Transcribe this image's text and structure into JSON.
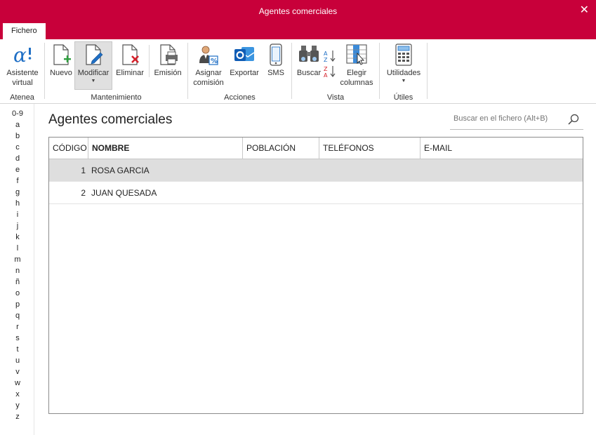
{
  "window": {
    "title": "Agentes comerciales",
    "close_glyph": "✕"
  },
  "tabs": [
    {
      "label": "Fichero",
      "active": true
    }
  ],
  "ribbon": {
    "groups": [
      {
        "label": "Atenea",
        "buttons": [
          {
            "label1": "Asistente",
            "label2": "virtual",
            "icon": "alpha-icon"
          }
        ]
      },
      {
        "label": "Mantenimiento",
        "buttons": [
          {
            "label1": "Nuevo",
            "icon": "new-document-icon"
          },
          {
            "label1": "Modificar",
            "icon": "edit-document-icon",
            "selected": true,
            "has_dropdown": true
          },
          {
            "label1": "Eliminar",
            "icon": "delete-document-icon"
          },
          {
            "label1": "Emisión",
            "icon": "print-document-icon"
          }
        ]
      },
      {
        "label": "Acciones",
        "buttons": [
          {
            "label1": "Asignar",
            "label2": "comisión",
            "icon": "assign-commission-icon"
          },
          {
            "label1": "Exportar",
            "icon": "outlook-icon"
          },
          {
            "label1": "SMS",
            "icon": "phone-icon"
          }
        ]
      },
      {
        "label": "Vista",
        "buttons": [
          {
            "label1": "Buscar",
            "icon": "binoculars-icon"
          },
          {
            "icon": "sort-az-icon"
          },
          {
            "icon": "sort-za-icon"
          },
          {
            "label1": "Elegir",
            "label2": "columnas",
            "icon": "choose-columns-icon"
          }
        ]
      },
      {
        "label": "Útiles",
        "buttons": [
          {
            "label1": "Utilidades",
            "icon": "calculator-icon",
            "has_dropdown": true
          }
        ]
      }
    ]
  },
  "alpha_index": [
    "0-9",
    "a",
    "b",
    "c",
    "d",
    "e",
    "f",
    "g",
    "h",
    "i",
    "j",
    "k",
    "l",
    "m",
    "n",
    "ñ",
    "o",
    "p",
    "q",
    "r",
    "s",
    "t",
    "u",
    "v",
    "w",
    "x",
    "y",
    "z"
  ],
  "main": {
    "title": "Agentes comerciales",
    "search": {
      "placeholder": "Buscar en el fichero (Alt+B)",
      "icon": "search-icon"
    }
  },
  "table": {
    "columns": [
      "CÓDIGO",
      "NOMBRE",
      "POBLACIÓN",
      "TELÉFONOS",
      "E-MAIL"
    ],
    "sorted_column": "NOMBRE",
    "rows": [
      {
        "codigo": "1",
        "nombre": "ROSA GARCIA",
        "poblacion": "",
        "telefonos": "",
        "email": "",
        "selected": true
      },
      {
        "codigo": "2",
        "nombre": "JUAN QUESADA",
        "poblacion": "",
        "telefonos": "",
        "email": "",
        "selected": false
      }
    ]
  },
  "colors": {
    "accent": "#c8003a",
    "selected_row": "#dedede",
    "selected_button": "#e0e0e0",
    "icon_blue": "#1f6fc5",
    "icon_green": "#2e9e3e",
    "icon_red": "#d4202a"
  }
}
